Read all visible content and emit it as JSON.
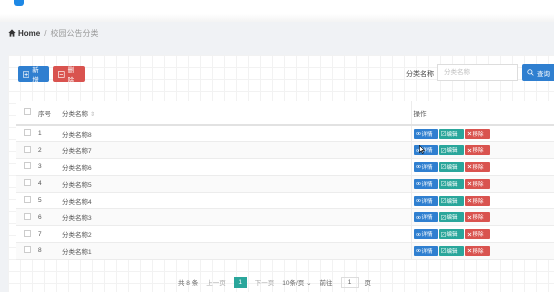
{
  "breadcrumb": {
    "home": "Home",
    "separator": "/",
    "current": "校园公告分类"
  },
  "toolbar": {
    "add_label": "新增",
    "delete_label": "删除"
  },
  "search": {
    "label": "分类名称",
    "placeholder": "分类名称",
    "button_label": "查询"
  },
  "table": {
    "headers": {
      "no": "序号",
      "name": "分类名称",
      "sort_icon": "⇕",
      "ops": "操作"
    },
    "row_actions": {
      "view": "详情",
      "edit": "编辑",
      "delete": "移除"
    },
    "rows": [
      {
        "no": "1",
        "name": "分类名称8"
      },
      {
        "no": "2",
        "name": "分类名称7"
      },
      {
        "no": "3",
        "name": "分类名称6"
      },
      {
        "no": "4",
        "name": "分类名称5"
      },
      {
        "no": "5",
        "name": "分类名称4"
      },
      {
        "no": "6",
        "name": "分类名称3"
      },
      {
        "no": "7",
        "name": "分类名称2"
      },
      {
        "no": "8",
        "name": "分类名称1"
      }
    ]
  },
  "pagination": {
    "total": "共 8 条",
    "prev": "上一页",
    "current_page": "1",
    "next": "下一页",
    "page_size": "10条/页",
    "page_size_arrow": "⌄",
    "goto_label": "前往",
    "goto_value": "1",
    "goto_unit": "页"
  },
  "colors": {
    "primary": "#2f7fd0",
    "danger": "#d9534f",
    "success": "#2aa69b"
  }
}
